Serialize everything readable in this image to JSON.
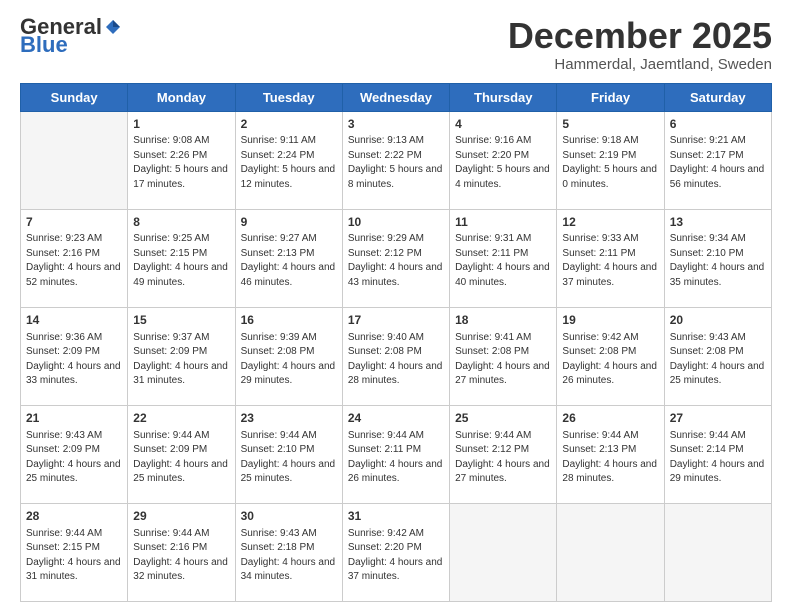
{
  "logo": {
    "general": "General",
    "blue": "Blue"
  },
  "header": {
    "month": "December 2025",
    "location": "Hammerdal, Jaemtland, Sweden"
  },
  "weekdays": [
    "Sunday",
    "Monday",
    "Tuesday",
    "Wednesday",
    "Thursday",
    "Friday",
    "Saturday"
  ],
  "weeks": [
    [
      {
        "day": "",
        "sunrise": "",
        "sunset": "",
        "daylight": ""
      },
      {
        "day": "1",
        "sunrise": "Sunrise: 9:08 AM",
        "sunset": "Sunset: 2:26 PM",
        "daylight": "Daylight: 5 hours and 17 minutes."
      },
      {
        "day": "2",
        "sunrise": "Sunrise: 9:11 AM",
        "sunset": "Sunset: 2:24 PM",
        "daylight": "Daylight: 5 hours and 12 minutes."
      },
      {
        "day": "3",
        "sunrise": "Sunrise: 9:13 AM",
        "sunset": "Sunset: 2:22 PM",
        "daylight": "Daylight: 5 hours and 8 minutes."
      },
      {
        "day": "4",
        "sunrise": "Sunrise: 9:16 AM",
        "sunset": "Sunset: 2:20 PM",
        "daylight": "Daylight: 5 hours and 4 minutes."
      },
      {
        "day": "5",
        "sunrise": "Sunrise: 9:18 AM",
        "sunset": "Sunset: 2:19 PM",
        "daylight": "Daylight: 5 hours and 0 minutes."
      },
      {
        "day": "6",
        "sunrise": "Sunrise: 9:21 AM",
        "sunset": "Sunset: 2:17 PM",
        "daylight": "Daylight: 4 hours and 56 minutes."
      }
    ],
    [
      {
        "day": "7",
        "sunrise": "Sunrise: 9:23 AM",
        "sunset": "Sunset: 2:16 PM",
        "daylight": "Daylight: 4 hours and 52 minutes."
      },
      {
        "day": "8",
        "sunrise": "Sunrise: 9:25 AM",
        "sunset": "Sunset: 2:15 PM",
        "daylight": "Daylight: 4 hours and 49 minutes."
      },
      {
        "day": "9",
        "sunrise": "Sunrise: 9:27 AM",
        "sunset": "Sunset: 2:13 PM",
        "daylight": "Daylight: 4 hours and 46 minutes."
      },
      {
        "day": "10",
        "sunrise": "Sunrise: 9:29 AM",
        "sunset": "Sunset: 2:12 PM",
        "daylight": "Daylight: 4 hours and 43 minutes."
      },
      {
        "day": "11",
        "sunrise": "Sunrise: 9:31 AM",
        "sunset": "Sunset: 2:11 PM",
        "daylight": "Daylight: 4 hours and 40 minutes."
      },
      {
        "day": "12",
        "sunrise": "Sunrise: 9:33 AM",
        "sunset": "Sunset: 2:11 PM",
        "daylight": "Daylight: 4 hours and 37 minutes."
      },
      {
        "day": "13",
        "sunrise": "Sunrise: 9:34 AM",
        "sunset": "Sunset: 2:10 PM",
        "daylight": "Daylight: 4 hours and 35 minutes."
      }
    ],
    [
      {
        "day": "14",
        "sunrise": "Sunrise: 9:36 AM",
        "sunset": "Sunset: 2:09 PM",
        "daylight": "Daylight: 4 hours and 33 minutes."
      },
      {
        "day": "15",
        "sunrise": "Sunrise: 9:37 AM",
        "sunset": "Sunset: 2:09 PM",
        "daylight": "Daylight: 4 hours and 31 minutes."
      },
      {
        "day": "16",
        "sunrise": "Sunrise: 9:39 AM",
        "sunset": "Sunset: 2:08 PM",
        "daylight": "Daylight: 4 hours and 29 minutes."
      },
      {
        "day": "17",
        "sunrise": "Sunrise: 9:40 AM",
        "sunset": "Sunset: 2:08 PM",
        "daylight": "Daylight: 4 hours and 28 minutes."
      },
      {
        "day": "18",
        "sunrise": "Sunrise: 9:41 AM",
        "sunset": "Sunset: 2:08 PM",
        "daylight": "Daylight: 4 hours and 27 minutes."
      },
      {
        "day": "19",
        "sunrise": "Sunrise: 9:42 AM",
        "sunset": "Sunset: 2:08 PM",
        "daylight": "Daylight: 4 hours and 26 minutes."
      },
      {
        "day": "20",
        "sunrise": "Sunrise: 9:43 AM",
        "sunset": "Sunset: 2:08 PM",
        "daylight": "Daylight: 4 hours and 25 minutes."
      }
    ],
    [
      {
        "day": "21",
        "sunrise": "Sunrise: 9:43 AM",
        "sunset": "Sunset: 2:09 PM",
        "daylight": "Daylight: 4 hours and 25 minutes."
      },
      {
        "day": "22",
        "sunrise": "Sunrise: 9:44 AM",
        "sunset": "Sunset: 2:09 PM",
        "daylight": "Daylight: 4 hours and 25 minutes."
      },
      {
        "day": "23",
        "sunrise": "Sunrise: 9:44 AM",
        "sunset": "Sunset: 2:10 PM",
        "daylight": "Daylight: 4 hours and 25 minutes."
      },
      {
        "day": "24",
        "sunrise": "Sunrise: 9:44 AM",
        "sunset": "Sunset: 2:11 PM",
        "daylight": "Daylight: 4 hours and 26 minutes."
      },
      {
        "day": "25",
        "sunrise": "Sunrise: 9:44 AM",
        "sunset": "Sunset: 2:12 PM",
        "daylight": "Daylight: 4 hours and 27 minutes."
      },
      {
        "day": "26",
        "sunrise": "Sunrise: 9:44 AM",
        "sunset": "Sunset: 2:13 PM",
        "daylight": "Daylight: 4 hours and 28 minutes."
      },
      {
        "day": "27",
        "sunrise": "Sunrise: 9:44 AM",
        "sunset": "Sunset: 2:14 PM",
        "daylight": "Daylight: 4 hours and 29 minutes."
      }
    ],
    [
      {
        "day": "28",
        "sunrise": "Sunrise: 9:44 AM",
        "sunset": "Sunset: 2:15 PM",
        "daylight": "Daylight: 4 hours and 31 minutes."
      },
      {
        "day": "29",
        "sunrise": "Sunrise: 9:44 AM",
        "sunset": "Sunset: 2:16 PM",
        "daylight": "Daylight: 4 hours and 32 minutes."
      },
      {
        "day": "30",
        "sunrise": "Sunrise: 9:43 AM",
        "sunset": "Sunset: 2:18 PM",
        "daylight": "Daylight: 4 hours and 34 minutes."
      },
      {
        "day": "31",
        "sunrise": "Sunrise: 9:42 AM",
        "sunset": "Sunset: 2:20 PM",
        "daylight": "Daylight: 4 hours and 37 minutes."
      },
      {
        "day": "",
        "sunrise": "",
        "sunset": "",
        "daylight": ""
      },
      {
        "day": "",
        "sunrise": "",
        "sunset": "",
        "daylight": ""
      },
      {
        "day": "",
        "sunrise": "",
        "sunset": "",
        "daylight": ""
      }
    ]
  ]
}
